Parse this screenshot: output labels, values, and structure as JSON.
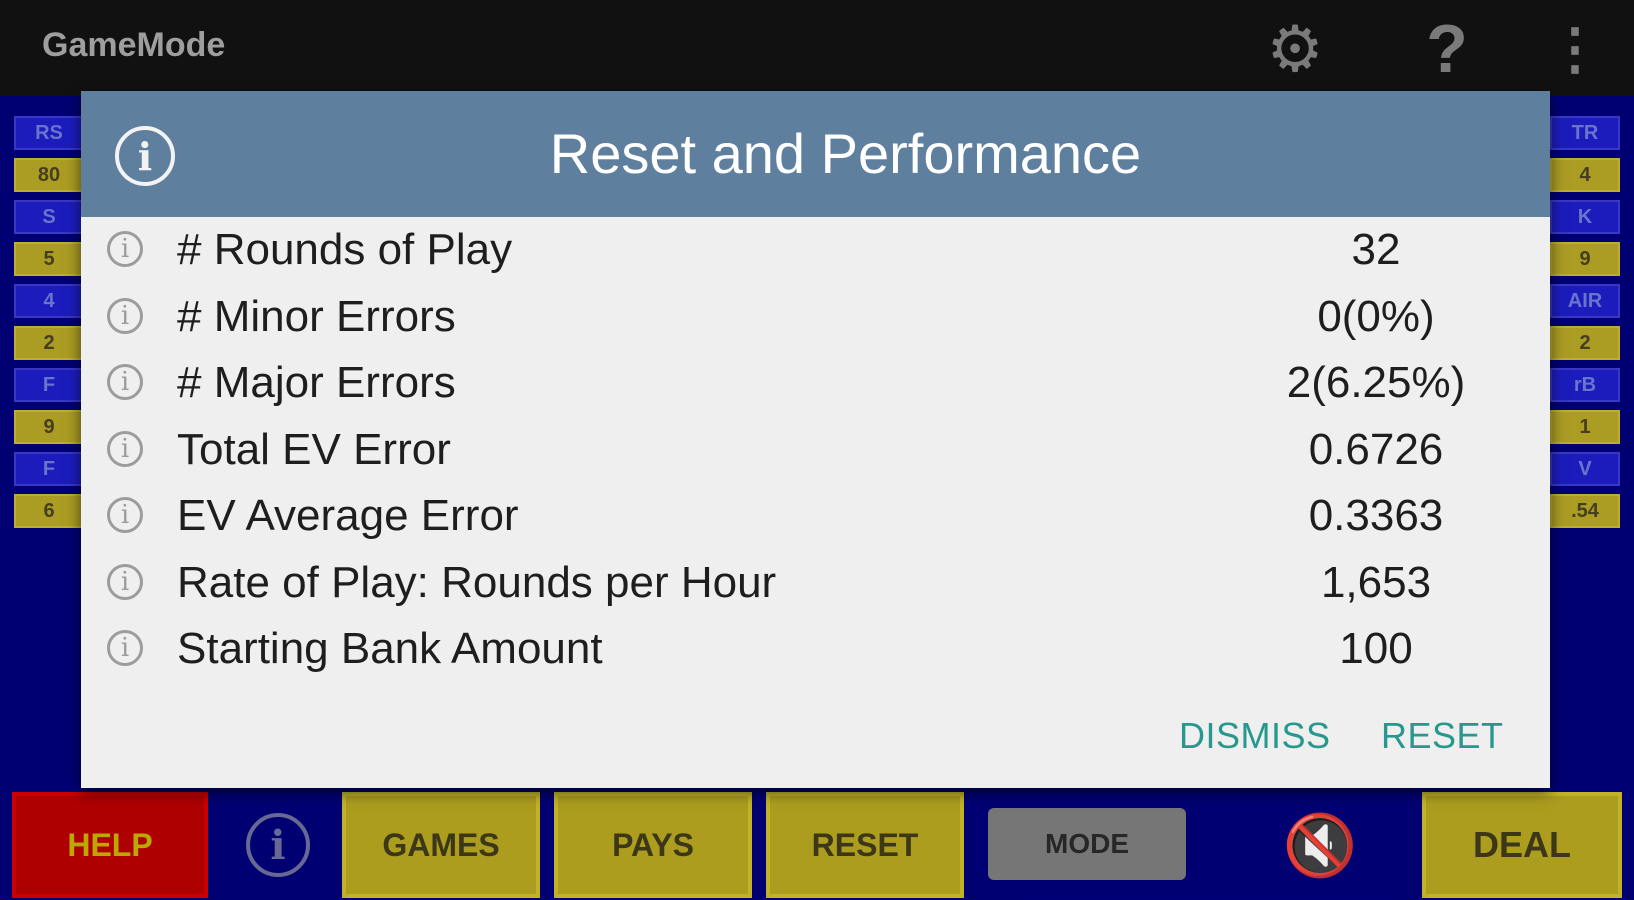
{
  "app_bar": {
    "title": "GameMode",
    "icons": [
      "settings-gear-icon",
      "help-question-icon",
      "overflow-menu-icon"
    ]
  },
  "paytable_fragments": {
    "left": [
      {
        "name": "RS",
        "value": "80"
      },
      {
        "name": "S",
        "value": "5"
      },
      {
        "name": "4",
        "value": "2"
      },
      {
        "name": "F",
        "value": "9"
      },
      {
        "name": "F",
        "value": "6"
      }
    ],
    "right": [
      {
        "name": "TR",
        "value": "4"
      },
      {
        "name": "K",
        "value": "9"
      },
      {
        "name": "AIR",
        "value": "2"
      },
      {
        "name": "rB",
        "value": "1"
      },
      {
        "name": "V",
        "value": ".54"
      }
    ]
  },
  "toolbar": {
    "help": "HELP",
    "games": "GAMES",
    "pays": "PAYS",
    "reset": "RESET",
    "mode": "MODE",
    "deal": "DEAL"
  },
  "dialog": {
    "title": "Reset and Performance",
    "rows": [
      {
        "label": "# Rounds of Play",
        "value": "32"
      },
      {
        "label": "# Minor Errors",
        "value": "0(0%)"
      },
      {
        "label": "# Major Errors",
        "value": "2(6.25%)"
      },
      {
        "label": "Total EV Error",
        "value": "0.6726"
      },
      {
        "label": "EV Average Error",
        "value": "0.3363"
      },
      {
        "label": "Rate of Play: Rounds per Hour",
        "value": "1,653"
      },
      {
        "label": "Starting Bank Amount",
        "value": "100"
      }
    ],
    "dismiss": "DISMISS",
    "reset": "RESET"
  },
  "colors": {
    "background": "#00007a",
    "dialog_header": "#5f7f9e",
    "dialog_body": "#efefef",
    "action_text": "#26988e",
    "toolbar_yellow": "#b6a621",
    "help_red": "#b80000"
  }
}
